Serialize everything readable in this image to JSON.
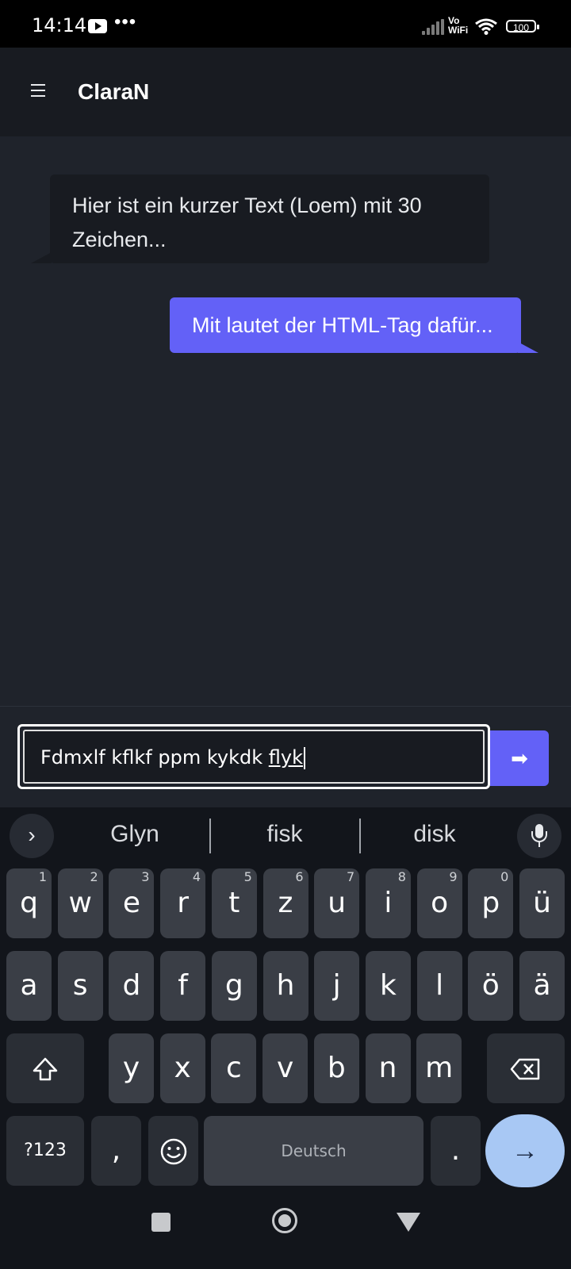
{
  "status_bar": {
    "time": "14:14",
    "dots": "•••",
    "network_label": "Vo WiFi",
    "battery": "100"
  },
  "app_bar": {
    "title": "ClaraN"
  },
  "chat": {
    "messages": [
      {
        "direction": "incoming",
        "text": "Hier ist ein kurzer Text (Loem) mit 30 Zeichen..."
      },
      {
        "direction": "outgoing",
        "text": "Mit lautet der HTML-Tag dafür..."
      }
    ]
  },
  "composer": {
    "input_value_prefix": "Fdmxlf kflkf ppm kykdk ",
    "input_value_composing": "flyk",
    "send_icon": "➡"
  },
  "keyboard": {
    "expand_icon": "›",
    "suggestions": [
      "Glyn",
      "fisk",
      "disk"
    ],
    "row1": [
      {
        "k": "q",
        "h": "1"
      },
      {
        "k": "w",
        "h": "2"
      },
      {
        "k": "e",
        "h": "3"
      },
      {
        "k": "r",
        "h": "4"
      },
      {
        "k": "t",
        "h": "5"
      },
      {
        "k": "z",
        "h": "6"
      },
      {
        "k": "u",
        "h": "7"
      },
      {
        "k": "i",
        "h": "8"
      },
      {
        "k": "o",
        "h": "9"
      },
      {
        "k": "p",
        "h": "0"
      },
      {
        "k": "ü",
        "h": ""
      }
    ],
    "row2": [
      "a",
      "s",
      "d",
      "f",
      "g",
      "h",
      "j",
      "k",
      "l",
      "ö",
      "ä"
    ],
    "row3": [
      "y",
      "x",
      "c",
      "v",
      "b",
      "n",
      "m"
    ],
    "symbols_label": "?123",
    "comma_label": ",",
    "space_label": "Deutsch",
    "period_label": ".",
    "enter_icon": "→",
    "accent_color": "#a8c8f4"
  },
  "colors": {
    "primary": "#6361f7",
    "background": "#1f232b",
    "surface": "#181b21"
  }
}
